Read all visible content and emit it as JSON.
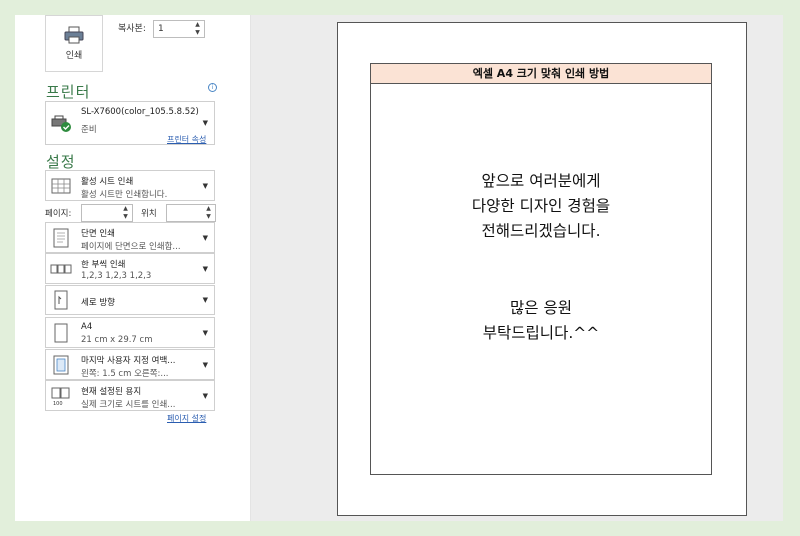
{
  "print": {
    "button_label": "인쇄",
    "copies_label": "복사본:",
    "copies_value": "1"
  },
  "printer": {
    "section_title": "프린터",
    "name": "SL-X7600(color_105.5.8.52)",
    "status": "준비",
    "properties_link": "프린터 속성"
  },
  "settings": {
    "section_title": "설정",
    "scope": {
      "title": "활성 시트 인쇄",
      "sub": "활성 시트만 인쇄합니다."
    },
    "pages_label": "페이지:",
    "pages_value": "",
    "to_label": "위치",
    "to_value": "",
    "sides": {
      "title": "단면 인쇄",
      "sub": "페이지에 단면으로 인쇄합..."
    },
    "collate": {
      "title": "한 부씩 인쇄",
      "sub": "1,2,3    1,2,3    1,2,3"
    },
    "orientation": {
      "title": "세로 방향"
    },
    "paper": {
      "title": "A4",
      "sub": "21 cm x 29.7 cm"
    },
    "margins": {
      "title": "마지막 사용자 지정 여백...",
      "sub": "왼쪽:  1.5 cm    오른쪽:..."
    },
    "scaling": {
      "title": "현재 설정된 용지",
      "sub": "실제 크기로 시트를 인쇄..."
    },
    "page_setup_link": "페이지 설정"
  },
  "preview": {
    "header": "엑셀 A4 크기 맞춰 인쇄 방법",
    "line1": "앞으로 여러분에게",
    "line2": "다양한 디자인 경험을",
    "line3": "전해드리겠습니다.",
    "line4": "많은 응원",
    "line5": "부탁드립니다.^^"
  },
  "icons": {
    "printer": "printer-icon",
    "printer_ready": "printer-ready-icon",
    "sheet": "sheet-icon",
    "one_sided": "one-sided-icon",
    "collate": "collate-icon",
    "portrait": "portrait-icon",
    "paper": "paper-icon",
    "margins": "margins-icon",
    "scale": "scale-icon",
    "info": "info-icon"
  },
  "colors": {
    "background": "#e2efdb",
    "section_title": "#3a7a4a",
    "link": "#2a5db0",
    "table_header": "#fbe3d5"
  }
}
